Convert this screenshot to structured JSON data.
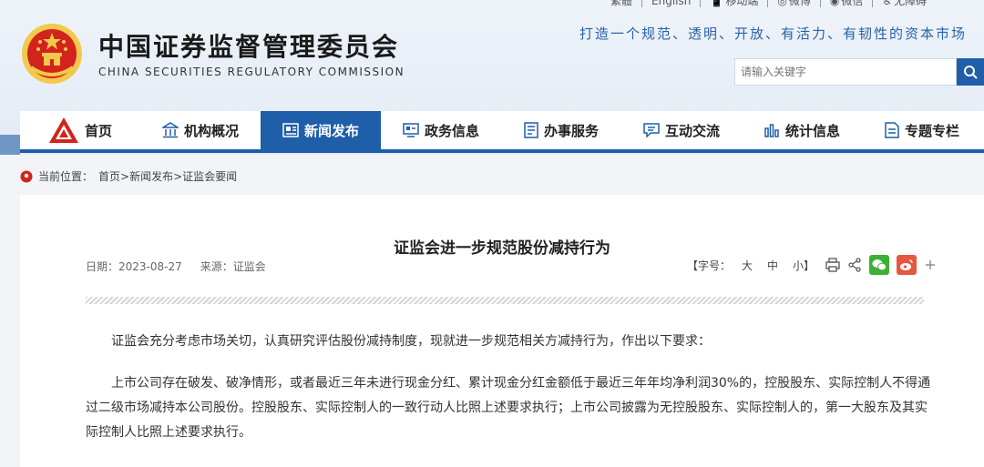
{
  "topbar": {
    "items": [
      "繁體",
      "English",
      "移动端",
      "微博",
      "微信",
      "无障碍"
    ]
  },
  "header": {
    "title": "中国证券监督管理委员会",
    "subtitle": "CHINA SECURITIES REGULATORY COMMISSION",
    "slogan": "打造一个规范、透明、开放、有活力、有韧性的资本市场"
  },
  "search": {
    "placeholder": "请输入关键字",
    "icon": "search-icon"
  },
  "nav": {
    "items": [
      {
        "label": "首页",
        "icon": "csrc-logo-icon"
      },
      {
        "label": "机构概况",
        "icon": "building-icon"
      },
      {
        "label": "新闻发布",
        "icon": "news-icon",
        "active": true
      },
      {
        "label": "政务信息",
        "icon": "monitor-icon"
      },
      {
        "label": "办事服务",
        "icon": "document-icon"
      },
      {
        "label": "互动交流",
        "icon": "chat-icon"
      },
      {
        "label": "统计信息",
        "icon": "bar-chart-icon"
      },
      {
        "label": "专题专栏",
        "icon": "file-icon"
      }
    ]
  },
  "breadcrumb": {
    "prefix": "当前位置：",
    "path": "首页>新闻发布>证监会要闻"
  },
  "article": {
    "title": "证监会进一步规范股份减持行为",
    "date": "日期：2023-08-27",
    "source": "来源：证监会",
    "font_size_label": "【字号：",
    "sizes": [
      "大",
      "中",
      "小】"
    ],
    "paragraphs": [
      "证监会充分考虑市场关切，认真研究评估股份减持制度，现就进一步规范相关方减持行为，作出以下要求：",
      "上市公司存在破发、破净情形，或者最近三年未进行现金分红、累计现金分红金额低于最近三年年均净利润30%的，控股股东、实际控制人不得通过二级市场减持本公司股份。控股股东、实际控制人的一致行动人比照上述要求执行；上市公司披露为无控股股东、实际控制人的，第一大股东及其实际控制人比照上述要求执行。"
    ]
  },
  "colors": {
    "primary": "#1f5ea8",
    "emblem_red": "#d2231d",
    "emblem_gold": "#f2c94c",
    "wechat": "#3cb035",
    "weibo": "#e5573e"
  }
}
